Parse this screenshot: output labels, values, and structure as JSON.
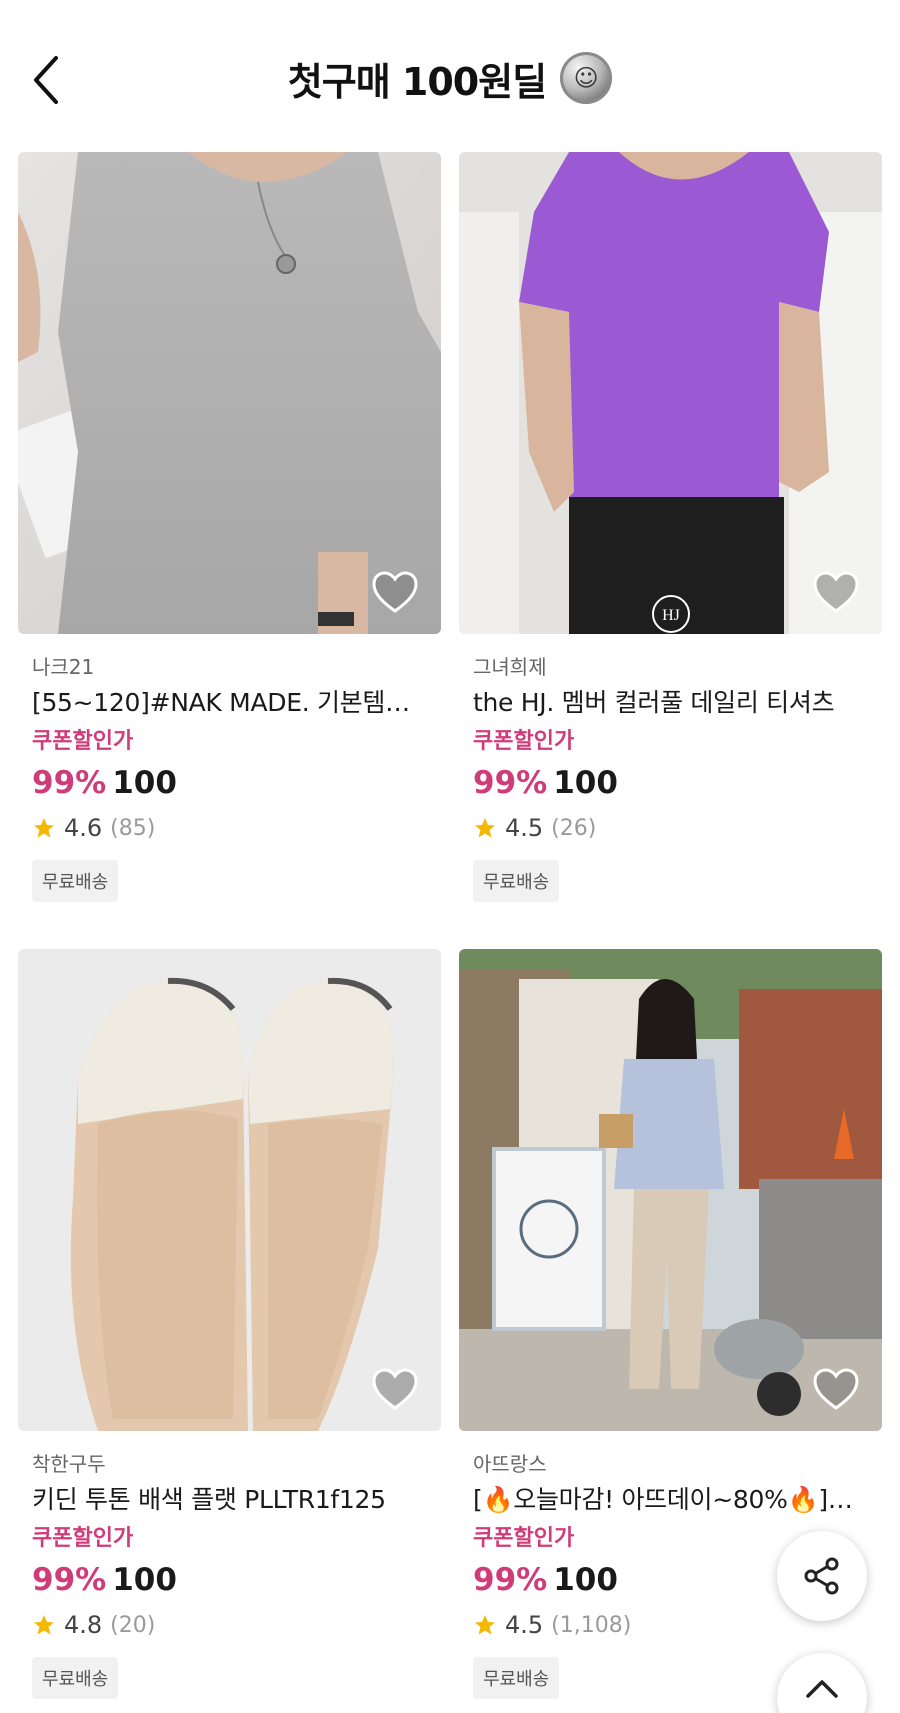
{
  "header": {
    "title": "첫구매 100원딜",
    "back_icon": "chevron-left-icon",
    "coin_icon": "coin-icon"
  },
  "products": [
    {
      "shop": "나크21",
      "name": "[55~120]#NAK MADE. 기본템은 …",
      "coupon_label": "쿠폰할인가",
      "discount": "99%",
      "price": "100",
      "rating": "4.6",
      "reviews": "(85)",
      "badge": "무료배송",
      "image": "gray-tshirt-photo"
    },
    {
      "shop": "그녀희제",
      "name": "the HJ. 멤버 컬러풀 데일리 티셔츠",
      "coupon_label": "쿠폰할인가",
      "discount": "99%",
      "price": "100",
      "rating": "4.5",
      "reviews": "(26)",
      "badge": "무료배송",
      "image": "purple-tshirt-photo"
    },
    {
      "shop": "착한구두",
      "name": "키딘 투톤 배색 플랫 PLLTR1f125",
      "coupon_label": "쿠폰할인가",
      "discount": "99%",
      "price": "100",
      "rating": "4.8",
      "reviews": "(20)",
      "badge": "무료배송",
      "image": "beige-flats-photo"
    },
    {
      "shop": "아뜨랑스",
      "name": "[🔥오늘마감! 아뜨데이~80%🔥]…",
      "coupon_label": "쿠폰할인가",
      "discount": "99%",
      "price": "100",
      "rating": "4.5",
      "reviews": "(1,108)",
      "badge": "무료배송",
      "image": "woman-outfit-street-photo"
    }
  ],
  "floating": {
    "share_icon": "share-icon",
    "top_icon": "chevron-up-icon"
  },
  "colors": {
    "accent": "#d03c7a",
    "star": "#f5b800",
    "badge_bg": "#f1f1f1"
  }
}
